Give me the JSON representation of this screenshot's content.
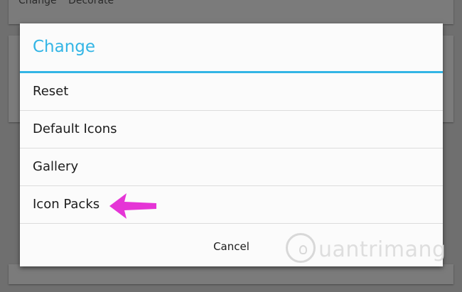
{
  "background": {
    "tabs": [
      "Change",
      "Decorate"
    ]
  },
  "dialog": {
    "title": "Change",
    "items": [
      {
        "label": "Reset"
      },
      {
        "label": "Default Icons"
      },
      {
        "label": "Gallery"
      },
      {
        "label": "Icon Packs"
      }
    ],
    "cancel_label": "Cancel"
  },
  "annotation": {
    "arrow_icon": "left-arrow-icon",
    "arrow_color": "#e535d6"
  },
  "watermark": {
    "text": "uantrimang",
    "logo_icon": "lightbulb-icon"
  },
  "colors": {
    "accent": "#33b5e5",
    "overlay": "#6f6f6f"
  }
}
